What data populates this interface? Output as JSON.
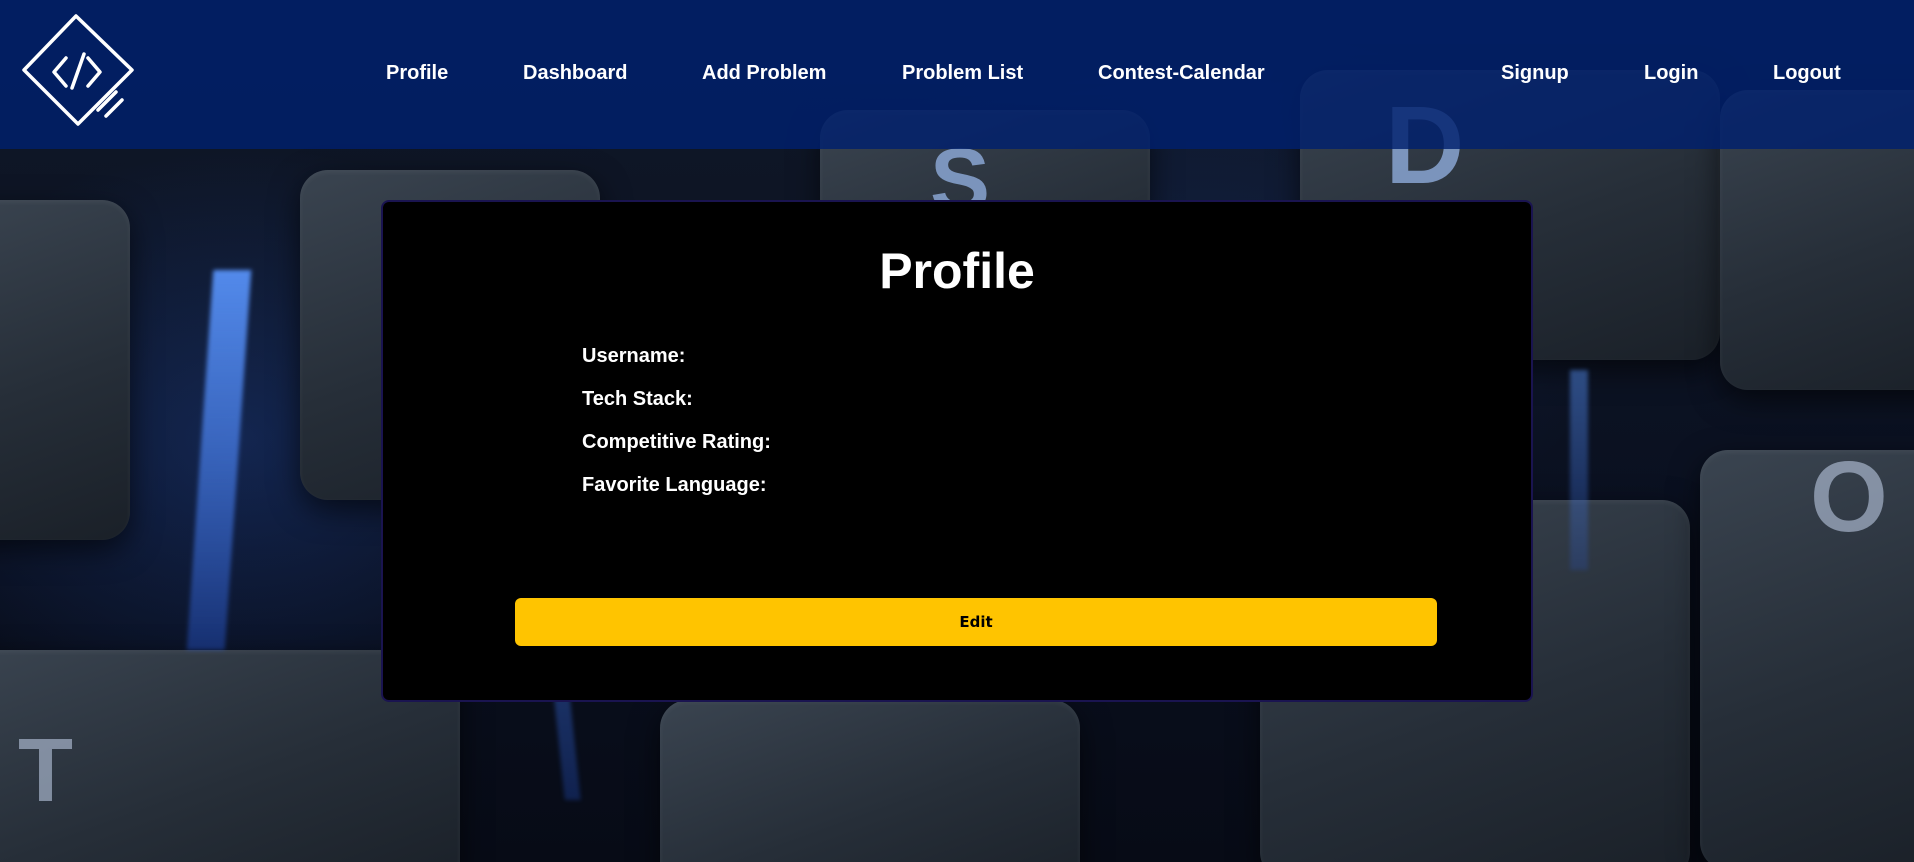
{
  "nav": {
    "links": [
      {
        "label": "Profile"
      },
      {
        "label": "Dashboard"
      },
      {
        "label": "Add Problem"
      },
      {
        "label": "Problem List"
      },
      {
        "label": "Contest-Calendar"
      }
    ],
    "auth": [
      {
        "label": "Signup"
      },
      {
        "label": "Login"
      },
      {
        "label": "Logout"
      }
    ]
  },
  "profile": {
    "title": "Profile",
    "fields": [
      {
        "label": "Username:"
      },
      {
        "label": "Tech Stack:"
      },
      {
        "label": "Competitive Rating:"
      },
      {
        "label": "Favorite Language:"
      }
    ],
    "edit_label": "Edit"
  },
  "colors": {
    "navbar": "#00206e",
    "card": "#000000",
    "accent": "#ffc400"
  },
  "icons": {
    "logo": "code-brackets-logo-icon"
  }
}
